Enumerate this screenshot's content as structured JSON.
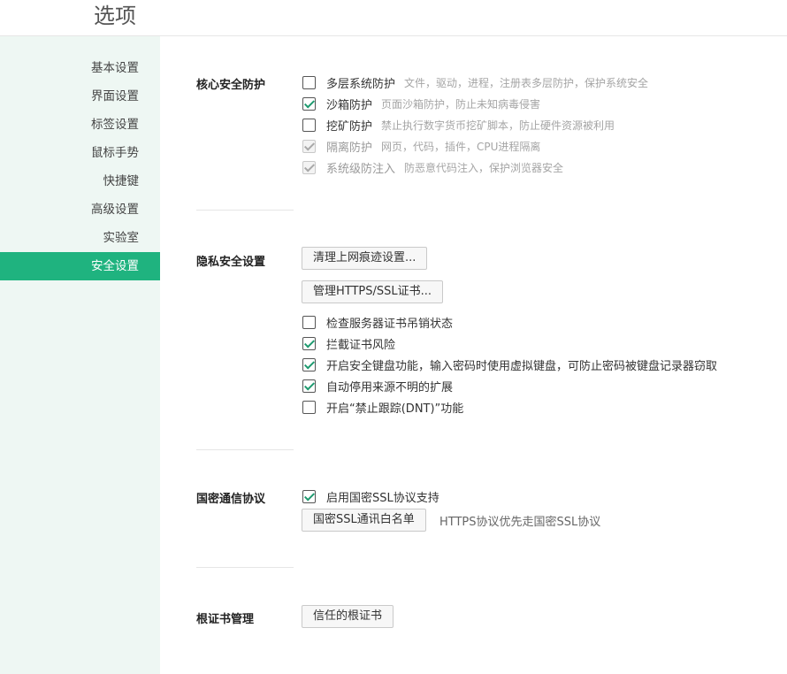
{
  "page": {
    "title": "选项"
  },
  "sidebar": {
    "items": [
      {
        "label": "基本设置",
        "active": false
      },
      {
        "label": "界面设置",
        "active": false
      },
      {
        "label": "标签设置",
        "active": false
      },
      {
        "label": "鼠标手势",
        "active": false
      },
      {
        "label": "快捷键",
        "active": false
      },
      {
        "label": "高级设置",
        "active": false
      },
      {
        "label": "实验室",
        "active": false
      },
      {
        "label": "安全设置",
        "active": true
      }
    ]
  },
  "core_protection": {
    "title": "核心安全防护",
    "options": [
      {
        "label": "多层系统防护",
        "desc": "文件，驱动，进程，注册表多层防护，保护系统安全",
        "checked": false,
        "disabled": false
      },
      {
        "label": "沙箱防护",
        "desc": "页面沙箱防护，防止未知病毒侵害",
        "checked": true,
        "disabled": false
      },
      {
        "label": "挖矿防护",
        "desc": "禁止执行数字货币挖矿脚本，防止硬件资源被利用",
        "checked": false,
        "disabled": false
      },
      {
        "label": "隔离防护",
        "desc": "网页，代码，插件，CPU进程隔离",
        "checked": true,
        "disabled": true
      },
      {
        "label": "系统级防注入",
        "desc": "防恶意代码注入，保护浏览器安全",
        "checked": true,
        "disabled": true
      }
    ]
  },
  "privacy": {
    "title": "隐私安全设置",
    "clear_traces_button": "清理上网痕迹设置...",
    "manage_certs_button": "管理HTTPS/SSL证书...",
    "options": [
      {
        "label": "检查服务器证书吊销状态",
        "checked": false
      },
      {
        "label": "拦截证书风险",
        "checked": true
      },
      {
        "label": "开启安全键盘功能，输入密码时使用虚拟键盘，可防止密码被键盘记录器窃取",
        "checked": true
      },
      {
        "label": "自动停用来源不明的扩展",
        "checked": true
      },
      {
        "label": "开启“禁止跟踪(DNT)”功能",
        "checked": false
      }
    ]
  },
  "gm_ssl": {
    "title": "国密通信协议",
    "option": {
      "label": "启用国密SSL协议支持",
      "checked": true
    },
    "whitelist_button": "国密SSL通讯白名单",
    "note": "HTTPS协议优先走国密SSL协议"
  },
  "root_cert": {
    "title": "根证书管理",
    "trusted_button": "信任的根证书"
  }
}
